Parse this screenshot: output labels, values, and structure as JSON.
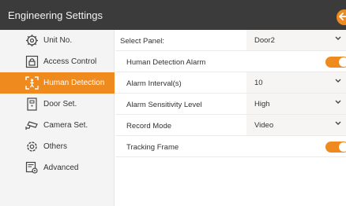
{
  "header": {
    "title": "Engineering Settings"
  },
  "sidebar": {
    "items": [
      {
        "label": "Unit No.",
        "icon": "unit-number-icon"
      },
      {
        "label": "Access Control",
        "icon": "lock-icon"
      },
      {
        "label": "Human Detection",
        "icon": "human-detection-icon",
        "active": true
      },
      {
        "label": "Door Set.",
        "icon": "door-icon"
      },
      {
        "label": "Camera Set.",
        "icon": "camera-icon"
      },
      {
        "label": "Others",
        "icon": "gear-icon"
      },
      {
        "label": "Advanced",
        "icon": "advanced-settings-icon"
      }
    ]
  },
  "main": {
    "select_panel": {
      "label": "Select Panel:",
      "value": "Door2"
    },
    "human_detection_alarm": {
      "label": "Human Detection Alarm",
      "on": true
    },
    "alarm_interval": {
      "label": "Alarm Interval(s)",
      "value": "10"
    },
    "sensitivity": {
      "label": "Alarm Sensitivity Level",
      "value": "High"
    },
    "record_mode": {
      "label": "Record Mode",
      "value": "Video"
    },
    "tracking_frame": {
      "label": "Tracking Frame",
      "on": true
    }
  },
  "colors": {
    "accent": "#ef8a1f",
    "header_bg": "#3b3b3b",
    "sidebar_bg": "#f4f4f4"
  }
}
